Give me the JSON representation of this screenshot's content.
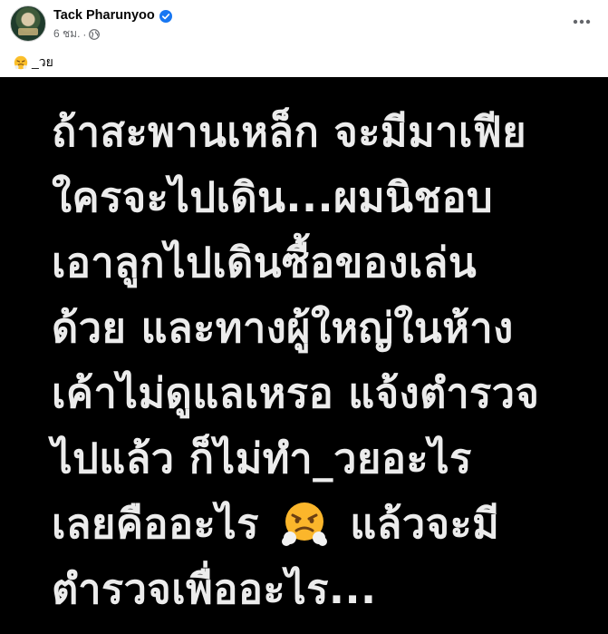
{
  "post": {
    "author": "Tack Pharunyoo",
    "timestamp": "6 ชม.",
    "separator": "·",
    "audience_icon": "globe-icon",
    "verified_icon": "verified-badge-icon",
    "more_icon": "more-options-icon",
    "caption_emoji": "steam-from-nose-face-emoji",
    "caption_text": "_วย",
    "colors": {
      "verified": "#1877f2",
      "meta_text": "#65676b",
      "name_text": "#050505",
      "photo_bg": "#000000",
      "photo_text": "#ececec"
    }
  },
  "photo": {
    "lines": [
      "ถ้าสะพานเหล็ก จะมีมาเฟีย",
      "ใครจะไปเดิน...ผมนิชอบ",
      "เอาลูกไปเดินซื้อของเล่น",
      "ด้วย และทางผู้ใหญ่ในห้าง",
      "เค้าไม่ดูแลเหรอ แจ้งตำรวจ",
      "ไปแล้ว ก็ไม่ทำ_วยอะไร",
      "เลยคืออะไร",
      "แล้วจะมี",
      "ตำรวจเพื่ออะไร..."
    ],
    "inline_emoji": "steam-from-nose-face-emoji"
  }
}
